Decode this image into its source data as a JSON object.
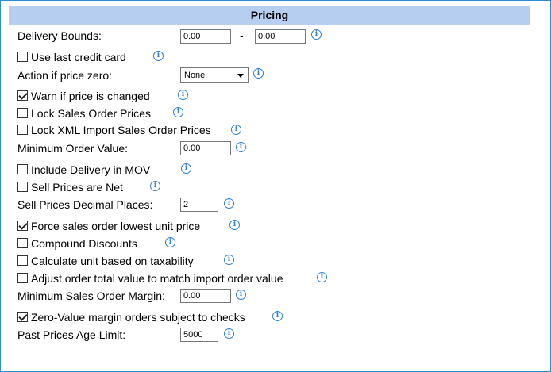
{
  "section": {
    "title": "Pricing"
  },
  "icons": {
    "info": "i"
  },
  "delivery_bounds": {
    "label": "Delivery Bounds:",
    "from": "0.00",
    "separator": "-",
    "to": "0.00"
  },
  "use_last_credit_card": {
    "label": "Use last credit card",
    "checked": false
  },
  "action_if_price_zero": {
    "label": "Action if price zero:",
    "value": "None"
  },
  "warn_if_price_changed": {
    "label": "Warn if price is changed",
    "checked": true
  },
  "lock_sales_order_prices": {
    "label": "Lock Sales Order Prices",
    "checked": false
  },
  "lock_xml_import_prices": {
    "label": "Lock XML Import Sales Order Prices",
    "checked": false
  },
  "minimum_order_value": {
    "label": "Minimum Order Value:",
    "value": "0.00"
  },
  "include_delivery_in_mov": {
    "label": "Include Delivery in MOV",
    "checked": false
  },
  "sell_prices_are_net": {
    "label": "Sell Prices are Net",
    "checked": false
  },
  "sell_prices_decimal_places": {
    "label": "Sell Prices Decimal Places:",
    "value": "2"
  },
  "force_lowest_unit_price": {
    "label": "Force sales order lowest unit price",
    "checked": true
  },
  "compound_discounts": {
    "label": "Compound Discounts",
    "checked": false
  },
  "calculate_unit_taxability": {
    "label": "Calculate unit based on taxability",
    "checked": false
  },
  "adjust_order_total": {
    "label": "Adjust order total value to match import order value",
    "checked": false
  },
  "minimum_sales_order_margin": {
    "label": "Minimum Sales Order Margin:",
    "value": "0.00"
  },
  "zero_value_margin_checks": {
    "label": "Zero-Value margin orders subject to checks",
    "checked": true
  },
  "past_prices_age_limit": {
    "label": "Past Prices Age Limit:",
    "value": "5000"
  }
}
